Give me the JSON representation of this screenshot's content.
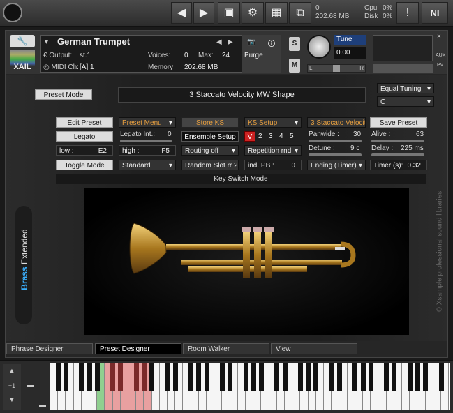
{
  "topbar": {
    "cpu_label": "Cpu",
    "cpu_val": "0%",
    "disk_label": "Disk",
    "disk_val": "0%",
    "mem": "202.68 MB",
    "voices_count": "0",
    "ni_logo": "NI",
    "icons": [
      "logo-icon",
      "prev-icon",
      "next-icon",
      "save-icon",
      "gear-icon",
      "layout-icon",
      "resize-icon",
      "warning-icon"
    ]
  },
  "header": {
    "instrument": "German Trumpet",
    "output_label": "Output:",
    "output_val": "st.1",
    "midi_label": "MIDI Ch:",
    "midi_val": "[A]  1",
    "voices_label": "Voices:",
    "voices_val": "0",
    "max_label": "Max:",
    "max_val": "24",
    "memory_label": "Memory:",
    "memory_val": "202.68 MB",
    "purge": "Purge",
    "s": "S",
    "m": "M",
    "tune_label": "Tune",
    "tune_val": "0.00",
    "pan_l": "L",
    "pan_r": "R",
    "aux": "AUX",
    "pv": "PV",
    "close": "×",
    "xail": "XAIL"
  },
  "panel": {
    "preset_mode": "Preset Mode",
    "title": "3 Staccato Velocity MW Shape",
    "tuning": "Equal Tuning",
    "key": "C",
    "row1": {
      "edit": "Edit Preset",
      "preset_menu": "Preset Menu",
      "store": "Store KS",
      "ks_setup": "KS Setup",
      "staccato": "3 Staccato Velocit",
      "save": "Save Preset"
    },
    "row2": {
      "legato": "Legato",
      "legato_int_label": "Legato Int.:",
      "legato_int": "0",
      "ensemble": "Ensemble Setup",
      "v": "V",
      "n2": "2",
      "n3": "3",
      "n4": "4",
      "n5": "5",
      "panwide_label": "Panwide :",
      "panwide": "30",
      "alive_label": "Alive :",
      "alive": "63"
    },
    "row3": {
      "low_label": "low :",
      "low": "E2",
      "high_label": "high :",
      "high": "F5",
      "routing": "Routing off",
      "repetition": "Repetition rnd",
      "detune_label": "Detune :",
      "detune": "9 c",
      "delay_label": "Delay :",
      "delay": "225 ms"
    },
    "row4": {
      "toggle": "Toggle Mode",
      "standard": "Standard",
      "random": "Random Slot rr 2",
      "indpb_label": "ind. PB :",
      "indpb": "0",
      "ending": "Ending (Timer)",
      "timer_label": "Timer (s):",
      "timer": "0.32"
    },
    "ks_mode": "Key Switch Mode",
    "brand_a": "Brass",
    "brand_b": "Extended",
    "copyright": "© Xsample professional sound libraries"
  },
  "tabs": [
    "Phrase Designer",
    "Preset Designer",
    "Room Walker",
    "View"
  ],
  "keyboard": {
    "octave": "+1"
  }
}
